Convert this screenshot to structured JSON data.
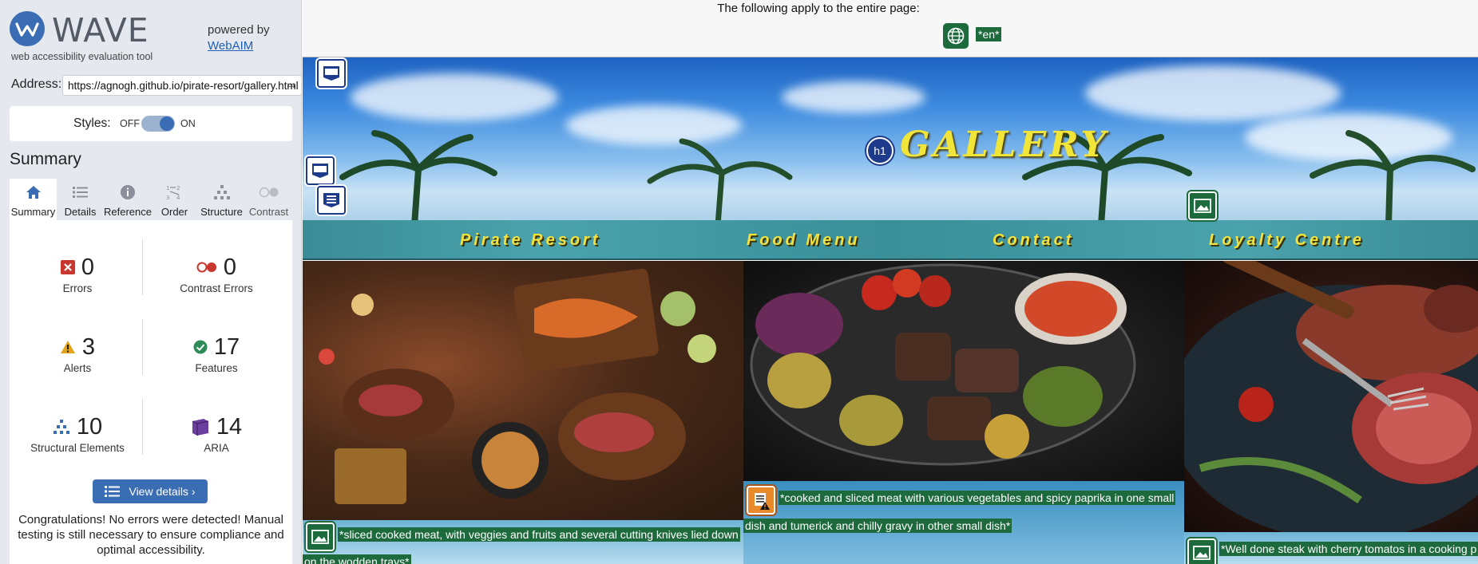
{
  "app": {
    "logo_text": "WAVE",
    "tagline": "web accessibility evaluation tool",
    "powered_by": "powered by",
    "webaim_link": "WebAIM"
  },
  "address": {
    "label": "Address:",
    "value": "https://agnogh.github.io/pirate-resort/gallery.html",
    "go_icon": "arrow-right-icon"
  },
  "styles": {
    "label": "Styles:",
    "off": "OFF",
    "on": "ON",
    "state": "on"
  },
  "summary": {
    "title": "Summary",
    "tabs": [
      {
        "label": "Summary",
        "icon": "home-icon",
        "active": true
      },
      {
        "label": "Details",
        "icon": "list-icon"
      },
      {
        "label": "Reference",
        "icon": "info-icon"
      },
      {
        "label": "Order",
        "icon": "order-icon"
      },
      {
        "label": "Structure",
        "icon": "structure-icon"
      },
      {
        "label": "Contrast",
        "icon": "contrast-icon"
      }
    ],
    "stats": {
      "errors": {
        "count": "0",
        "label": "Errors",
        "color": "#c8372d"
      },
      "contrast_errors": {
        "count": "0",
        "label": "Contrast Errors",
        "color": "#c8372d"
      },
      "alerts": {
        "count": "3",
        "label": "Alerts",
        "color": "#e2a21c"
      },
      "features": {
        "count": "17",
        "label": "Features",
        "color": "#2e8b57"
      },
      "structural": {
        "count": "10",
        "label": "Structural Elements",
        "color": "#3a6db4"
      },
      "aria": {
        "count": "14",
        "label": "ARIA",
        "color": "#6b3fa0"
      }
    },
    "view_details": "View details ›",
    "congrats": "Congratulations! No errors were detected! Manual testing is still necessary to ensure compliance and optimal accessibility."
  },
  "page": {
    "banner_text": "The following apply to the entire page:",
    "lang_tag": "*en*",
    "hero_title": "GALLERY",
    "h1_badge": "h1",
    "nav": [
      "Pirate Resort",
      "Food Menu",
      "Contact",
      "Loyalty Centre"
    ],
    "alts": [
      "*sliced cooked meat, with veggies and fruits and several cutting knives lied down",
      "on the wodden trays*",
      "*cooked and sliced meat with various vegetables and spicy paprika in one small",
      "dish and tumerick and chilly gravy in other small dish*",
      "*Well done steak with cherry tomatos in a cooking p"
    ]
  },
  "colors": {
    "accent": "#3a6db4",
    "feature_green": "#1d6a3d",
    "nav_text": "#f4e23c"
  }
}
